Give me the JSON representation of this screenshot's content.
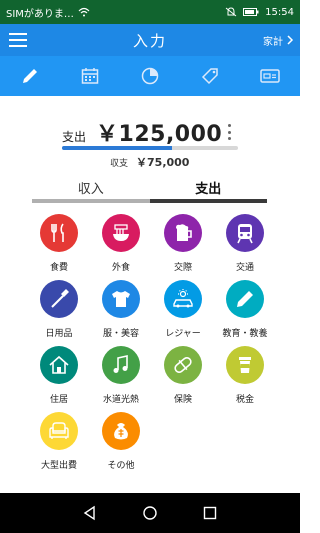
{
  "status_bar": {
    "carrier": "SIMがありま…",
    "time": "15:54",
    "icons": [
      "wifi-icon",
      "mute-icon",
      "battery-icon"
    ]
  },
  "app_bar": {
    "title": "入力",
    "menu_icon": "hamburger-menu-icon",
    "right_label": "家計",
    "right_icon": "chevron-right-icon"
  },
  "toolbar": {
    "items": [
      {
        "icon": "pencil-icon",
        "active": true
      },
      {
        "icon": "calendar-icon",
        "active": false
      },
      {
        "icon": "pie-chart-icon",
        "active": false
      },
      {
        "icon": "tag-icon",
        "active": false
      },
      {
        "icon": "card-icon",
        "active": false
      }
    ]
  },
  "summary": {
    "label": "支出",
    "amount": "￥125,000",
    "income_label": "収支",
    "income_value": "￥75,000",
    "progress_fraction": 0.625
  },
  "tabs": [
    {
      "label": "収入",
      "active": false
    },
    {
      "label": "支出",
      "active": true
    }
  ],
  "categories": [
    {
      "label": "食費",
      "color": "#e53935",
      "icon": "fork-knife-icon"
    },
    {
      "label": "外食",
      "color": "#d81b60",
      "icon": "noodle-bowl-icon"
    },
    {
      "label": "交際",
      "color": "#8e24aa",
      "icon": "beer-mug-icon"
    },
    {
      "label": "交通",
      "color": "#5e35b1",
      "icon": "train-icon"
    },
    {
      "label": "日用品",
      "color": "#3949ab",
      "icon": "toothbrush-icon"
    },
    {
      "label": "服・美容",
      "color": "#1e88e5",
      "icon": "tshirt-icon"
    },
    {
      "label": "レジャー",
      "color": "#039be5",
      "icon": "car-sun-icon"
    },
    {
      "label": "教育・教養",
      "color": "#00acc1",
      "icon": "pencil-icon"
    },
    {
      "label": "住居",
      "color": "#00897b",
      "icon": "house-icon"
    },
    {
      "label": "水道光熱",
      "color": "#43a047",
      "icon": "music-note-icon"
    },
    {
      "label": "保険",
      "color": "#7cb342",
      "icon": "capsule-icon"
    },
    {
      "label": "税金",
      "color": "#c0ca33",
      "icon": "cup-icon"
    },
    {
      "label": "大型出費",
      "color": "#fdd835",
      "icon": "sofa-icon"
    },
    {
      "label": "その他",
      "color": "#fb8c00",
      "icon": "bag-icon"
    }
  ],
  "nav_bar": {
    "icons": [
      "back-icon",
      "home-icon",
      "recents-icon"
    ]
  }
}
